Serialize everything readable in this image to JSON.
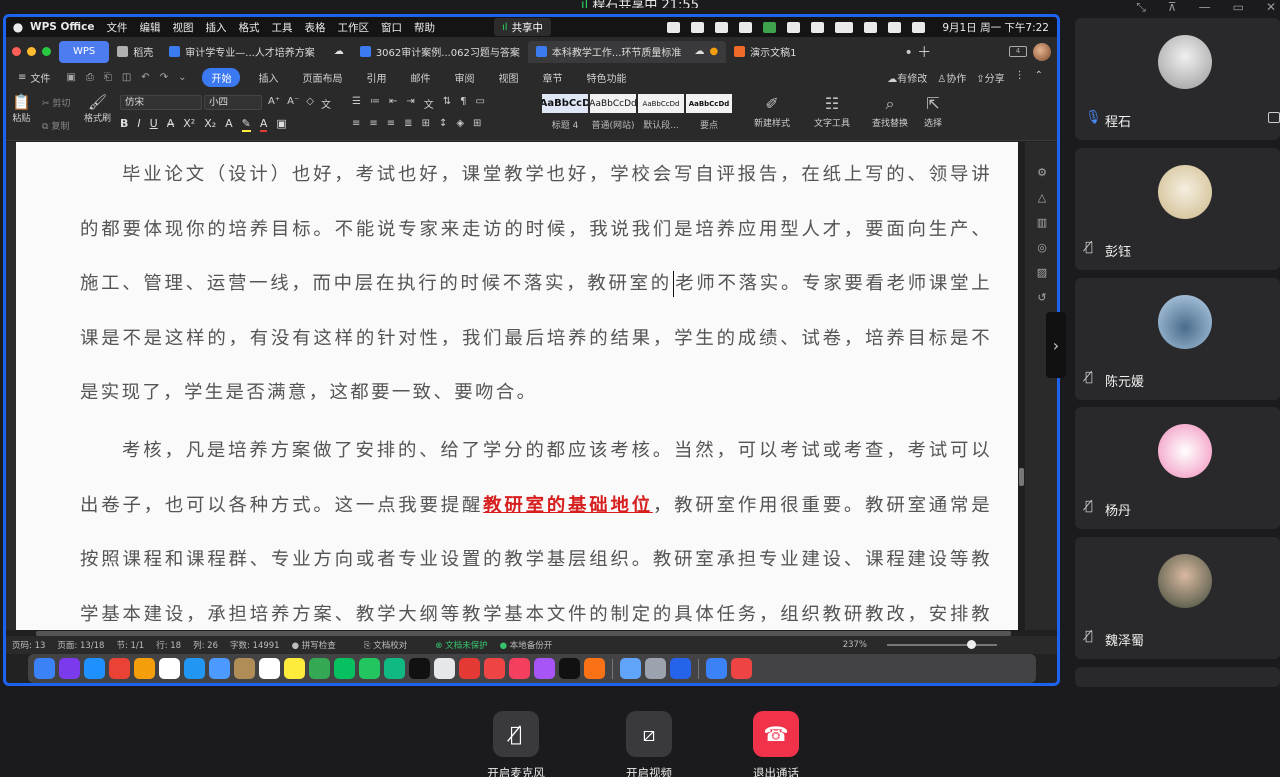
{
  "share_banner": {
    "signal": "ıl",
    "title": "程石共享中 21:55"
  },
  "shared_screen": {
    "menubar": {
      "app_name": "WPS Office",
      "items": [
        "文件",
        "编辑",
        "视图",
        "插入",
        "格式",
        "工具",
        "表格",
        "工作区",
        "窗口",
        "帮助"
      ],
      "share_label": "共享中",
      "datetime": "9月1日 周一 下午7:22"
    },
    "tabs": {
      "wps_label": "WPS",
      "items": [
        {
          "label": "稻壳",
          "color": "#b0b0b0"
        },
        {
          "label": "审计学专业—...人才培养方案",
          "color": "#3a7bf0"
        },
        {
          "label": "3062审计案例...062习题与答案",
          "color": "#3a7bf0"
        },
        {
          "label": "本科教学工作...环节质量标准",
          "color": "#3a7bf0"
        },
        {
          "label": "演示文稿1",
          "color": "#f06a2a"
        }
      ]
    },
    "ribbon": {
      "file_label": "文件",
      "tabs": [
        "开始",
        "插入",
        "页面布局",
        "引用",
        "邮件",
        "审阅",
        "视图",
        "章节",
        "特色功能"
      ],
      "active_tab": "开始",
      "right": [
        "有修改",
        "协作",
        "分享"
      ]
    },
    "toolbar": {
      "paste_label": "粘贴",
      "cut_label": "剪切",
      "copy_label": "复制",
      "format_painter_label": "格式刷",
      "font_name": "仿宋",
      "font_size": "小四",
      "style_previews": [
        "AaBbCcD",
        "AaBbCcDd",
        "AaBbCcDd",
        "AaBbCcDd"
      ],
      "style_labels": [
        "标题 4",
        "普通(网站)",
        "默认段...",
        "要点"
      ],
      "new_style_label": "新建样式",
      "text_tools_label": "文字工具",
      "find_replace_label": "查找替换",
      "select_label": "选择"
    },
    "document": {
      "para1_before_cursor": "毕业论文（设计）也好，考试也好，课堂教学也好，学校会写自评报告，在纸上写的、领导讲的都要体现你的培养目标。不能说专家来走访的时候，我说我们是培养应用型人才，要面向生产、施工、管理、运营一线，而中层在执行的时候不落实，教研室的",
      "para1_after_cursor": "老师不落实。专家要看老师课堂上课是不是这样的，有没有这样的针对性，我们最后培养的结果，学生的成绩、试卷，培养目标是不是实现了，学生是否满意，这都要一致、要吻合。",
      "para2_before": "考核，凡是培养方案做了安排的、给了学分的都应该考核。当然，可以考试或考查，考试可以出卷子，也可以各种方式。这一点我要提醒",
      "para2_highlight": "教研室的基础地位",
      "para2_after": "，教研室作用很重要。教研室通常是按照课程和课程群、专业方向或者专业设置的教学基层组织。教研室承担专业建设、课程建设等教学基本建设，承担培养方案、教学大纲等教学基本文件的制定的具体任务，组织教研教改，安排教学任务并"
    },
    "statusbar": {
      "page_count": "页码: 13",
      "page": "页面: 13/18",
      "section": "节: 1/1",
      "row": "行: 18",
      "col": "列: 26",
      "word_count": "字数: 14991",
      "spell_check": "拼写检查",
      "doc_proof": "文档校对",
      "doc_protect": "文档未保护",
      "local_backup": "本地备份开",
      "zoom": "237%"
    },
    "dock_colors": [
      "#3b82f6",
      "#7c3aed",
      "#1e90ff",
      "#ea4335",
      "#f59e0b",
      "#ffffff",
      "#2196f3",
      "#4c9aff",
      "#b08d57",
      "#ffffff",
      "#ffeb3b",
      "#34a853",
      "#07c160",
      "#22c55e",
      "#10b981",
      "#111111",
      "#e5e7eb",
      "#e53935",
      "#ef4444",
      "#f43f5e",
      "#a855f7",
      "#111111",
      "#f97316",
      "#60a5fa",
      "#9ca3af",
      "#2563eb",
      "#3b82f6",
      "#ef4444"
    ]
  },
  "participants": [
    {
      "name": "程石",
      "avatar_color": "#d8d8d8",
      "muted": false
    },
    {
      "name": "彭钰",
      "avatar_color": "#e7d9b5",
      "muted": true
    },
    {
      "name": "陈元媛",
      "avatar_color": "#8fb3d9",
      "muted": true
    },
    {
      "name": "杨丹",
      "avatar_color": "#f2a6c7",
      "muted": true
    },
    {
      "name": "魏泽蜀",
      "avatar_color": "#6f7f6a",
      "muted": true
    }
  ],
  "call_controls": {
    "mic_label": "开启麦克风",
    "video_label": "开启视频",
    "leave_label": "退出通话",
    "leave_color": "#f0334b"
  }
}
